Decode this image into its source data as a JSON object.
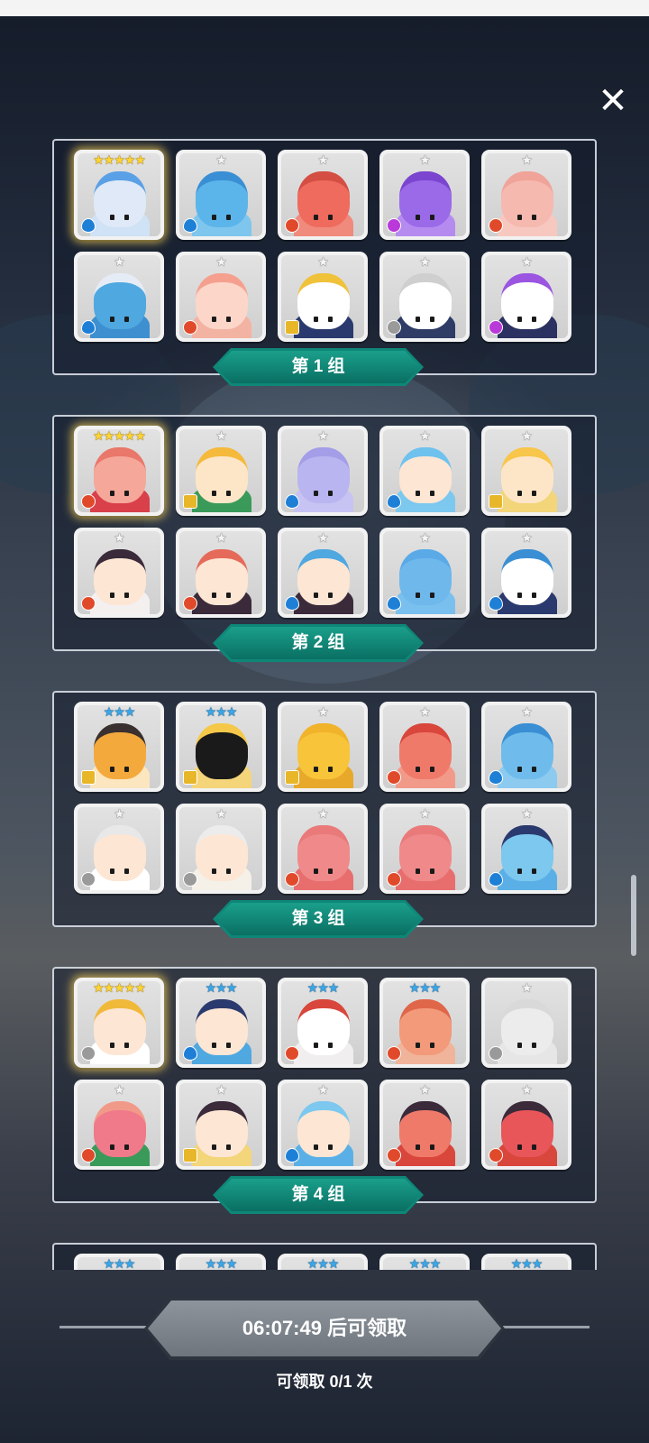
{
  "close_label": "✕",
  "groups": [
    {
      "label": "第 1 组",
      "heroes": [
        {
          "stars": "★★★★★",
          "tier": "gold",
          "element": "water",
          "head": "#dfe9f7",
          "hair": "#5aa0e6",
          "body": "#cfe2f6"
        },
        {
          "stars": "★",
          "tier": "grey",
          "element": "water",
          "head": "#5cb5ea",
          "hair": "#3a8fd4",
          "body": "#7fc6ee"
        },
        {
          "stars": "★",
          "tier": "grey",
          "element": "fire",
          "head": "#ee6b5d",
          "hair": "#d44e43",
          "body": "#f08a7c"
        },
        {
          "stars": "★",
          "tier": "grey",
          "element": "dark",
          "head": "#9b6ae8",
          "hair": "#7b45d0",
          "body": "#b58bf0"
        },
        {
          "stars": "★",
          "tier": "grey",
          "element": "fire",
          "head": "#f5b9b0",
          "hair": "#f0a398",
          "body": "#f7c8c0"
        },
        {
          "stars": "★",
          "tier": "grey",
          "element": "water",
          "head": "#4fa8e0",
          "hair": "#e6ecf6",
          "body": "#3d8fd0"
        },
        {
          "stars": "★",
          "tier": "grey",
          "element": "fire",
          "head": "#fbd6c9",
          "hair": "#f5a08e",
          "body": "#f3b3a2"
        },
        {
          "stars": "★",
          "tier": "grey",
          "element": "light",
          "head": "#ffffff",
          "hair": "#f0c23a",
          "body": "#2a3a6e"
        },
        {
          "stars": "★",
          "tier": "grey",
          "element": "wind",
          "head": "#ffffff",
          "hair": "#cfcfcf",
          "body": "#2e3c66"
        },
        {
          "stars": "★",
          "tier": "grey",
          "element": "dark",
          "head": "#ffffff",
          "hair": "#9b55e0",
          "body": "#2b3160"
        }
      ]
    },
    {
      "label": "第 2 组",
      "heroes": [
        {
          "stars": "★★★★★",
          "tier": "gold",
          "element": "fire",
          "head": "#f5a79a",
          "hair": "#e9776a",
          "body": "#d9404a"
        },
        {
          "stars": "★",
          "tier": "grey",
          "element": "light",
          "head": "#fde6c8",
          "hair": "#f5b93c",
          "body": "#3a9a5a"
        },
        {
          "stars": "★",
          "tier": "grey",
          "element": "water",
          "head": "#b9b5f0",
          "hair": "#a49ee8",
          "body": "#c7c3f3"
        },
        {
          "stars": "★",
          "tier": "grey",
          "element": "water",
          "head": "#fde6d4",
          "hair": "#6fc2ee",
          "body": "#7cc8ef"
        },
        {
          "stars": "★",
          "tier": "grey",
          "element": "light",
          "head": "#fde6c8",
          "hair": "#f7c64a",
          "body": "#f3d57a"
        },
        {
          "stars": "★",
          "tier": "grey",
          "element": "fire",
          "head": "#fde6d4",
          "hair": "#3a2a3a",
          "body": "#f4f0f0"
        },
        {
          "stars": "★",
          "tier": "grey",
          "element": "fire",
          "head": "#fde6d4",
          "hair": "#e66a5a",
          "body": "#3a2a3a"
        },
        {
          "stars": "★",
          "tier": "grey",
          "element": "water",
          "head": "#fde6d4",
          "hair": "#4fa8e0",
          "body": "#3a2a3a"
        },
        {
          "stars": "★",
          "tier": "grey",
          "element": "water",
          "head": "#6fb8ec",
          "hair": "#5aaae8",
          "body": "#79c0ee"
        },
        {
          "stars": "★",
          "tier": "grey",
          "element": "water",
          "head": "#ffffff",
          "hair": "#3a8fd4",
          "body": "#2b3a6e"
        }
      ]
    },
    {
      "label": "第 3 组",
      "heroes": [
        {
          "stars": "★★★",
          "tier": "blue",
          "element": "light",
          "head": "#f4a93c",
          "hair": "#3a3030",
          "body": "#fbe6c0"
        },
        {
          "stars": "★★★",
          "tier": "blue",
          "element": "light",
          "head": "#1a1a1a",
          "hair": "#f5c84a",
          "body": "#f5d57a"
        },
        {
          "stars": "★",
          "tier": "grey",
          "element": "light",
          "head": "#f7c43a",
          "hair": "#f0b32a",
          "body": "#e8a82a"
        },
        {
          "stars": "★",
          "tier": "grey",
          "element": "fire",
          "head": "#f07a6a",
          "hair": "#d9463c",
          "body": "#f29a8a"
        },
        {
          "stars": "★",
          "tier": "grey",
          "element": "water",
          "head": "#6fbcec",
          "hair": "#3a8fd4",
          "body": "#8ccaf0"
        },
        {
          "stars": "★",
          "tier": "grey",
          "element": "wind",
          "head": "#fde6d4",
          "hair": "#e8e8e8",
          "body": "#ffffff"
        },
        {
          "stars": "★",
          "tier": "grey",
          "element": "wind",
          "head": "#fde6d4",
          "hair": "#ececec",
          "body": "#f5f0e8"
        },
        {
          "stars": "★",
          "tier": "grey",
          "element": "fire",
          "head": "#f08a8a",
          "hair": "#ea7a7a",
          "body": "#e86e6e"
        },
        {
          "stars": "★",
          "tier": "grey",
          "element": "fire",
          "head": "#f08a8a",
          "hair": "#ea7a7a",
          "body": "#e86e6e"
        },
        {
          "stars": "★",
          "tier": "grey",
          "element": "water",
          "head": "#7cc8ef",
          "hair": "#2b3a6e",
          "body": "#5ab0e6"
        }
      ]
    },
    {
      "label": "第 4 组",
      "heroes": [
        {
          "stars": "★★★★★",
          "tier": "gold",
          "element": "wind",
          "head": "#fde6d4",
          "hair": "#f0b93a",
          "body": "#ffffff"
        },
        {
          "stars": "★★★",
          "tier": "blue",
          "element": "water",
          "head": "#fde6d4",
          "hair": "#2b3a6e",
          "body": "#4fa8e0"
        },
        {
          "stars": "★★★",
          "tier": "blue",
          "element": "fire",
          "head": "#ffffff",
          "hair": "#d9463c",
          "body": "#f0eeee"
        },
        {
          "stars": "★★★",
          "tier": "blue",
          "element": "fire",
          "head": "#f29a7a",
          "hair": "#e0664a",
          "body": "#f0b49a"
        },
        {
          "stars": "★",
          "tier": "grey",
          "element": "wind",
          "head": "#ececec",
          "hair": "#d9d9d9",
          "body": "#e6e6e6"
        },
        {
          "stars": "★",
          "tier": "grey",
          "element": "fire",
          "head": "#f07a8a",
          "hair": "#f29a8a",
          "body": "#3a9a5a"
        },
        {
          "stars": "★",
          "tier": "grey",
          "element": "light",
          "head": "#fde6d4",
          "hair": "#3a2a3a",
          "body": "#f3d57a"
        },
        {
          "stars": "★",
          "tier": "grey",
          "element": "water",
          "head": "#fde6d4",
          "hair": "#7cc8ef",
          "body": "#5ab0e6"
        },
        {
          "stars": "★",
          "tier": "grey",
          "element": "fire",
          "head": "#f07a6a",
          "hair": "#3a2a3a",
          "body": "#d9463c"
        },
        {
          "stars": "★",
          "tier": "grey",
          "element": "fire",
          "head": "#e8565a",
          "hair": "#3a2a3a",
          "body": "#d9463c"
        }
      ]
    },
    {
      "label": "",
      "heroes": [
        {
          "stars": "★★★",
          "tier": "blue",
          "element": "water",
          "head": "#cfcfcf",
          "hair": "#cfcfcf",
          "body": "#cfcfcf"
        },
        {
          "stars": "★★★",
          "tier": "blue",
          "element": "water",
          "head": "#cfcfcf",
          "hair": "#cfcfcf",
          "body": "#cfcfcf"
        },
        {
          "stars": "★★★",
          "tier": "blue",
          "element": "fire",
          "head": "#cfcfcf",
          "hair": "#cfcfcf",
          "body": "#cfcfcf"
        },
        {
          "stars": "★★★",
          "tier": "blue",
          "element": "water",
          "head": "#cfcfcf",
          "hair": "#cfcfcf",
          "body": "#cfcfcf"
        },
        {
          "stars": "★★★",
          "tier": "blue",
          "element": "water",
          "head": "#cfcfcf",
          "hair": "#cfcfcf",
          "body": "#cfcfcf"
        }
      ]
    }
  ],
  "footer": {
    "timer_text": "06:07:49 后可领取",
    "claim_count": "可领取 0/1 次"
  }
}
